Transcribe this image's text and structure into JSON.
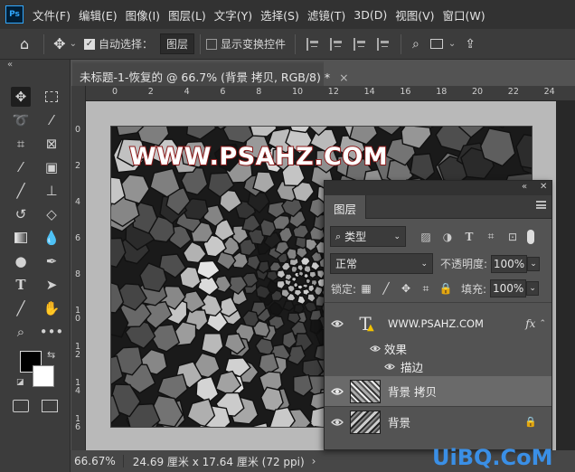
{
  "app": {
    "logo": "Ps"
  },
  "menu": [
    "文件(F)",
    "编辑(E)",
    "图像(I)",
    "图层(L)",
    "文字(Y)",
    "选择(S)",
    "滤镜(T)",
    "3D(D)",
    "视图(V)",
    "窗口(W)"
  ],
  "options": {
    "auto_select_label": "自动选择：",
    "auto_select_target": "图层",
    "show_transform_label": "显示变换控件"
  },
  "document": {
    "tab_title": "未标题-1-恢复的 @ 66.7% (背景 拷贝, RGB/8) *",
    "ruler_top": [
      "0",
      "2",
      "4",
      "6",
      "8",
      "10",
      "12",
      "14",
      "16",
      "18",
      "20",
      "22",
      "24"
    ],
    "ruler_left": [
      "0",
      "2",
      "4",
      "6",
      "8",
      "1\n0",
      "1\n2",
      "1\n4",
      "1\n6"
    ],
    "artwork_text": "WWW.PSAHZ.COM"
  },
  "status": {
    "zoom": "66.67%",
    "info": "24.69 厘米 x 17.64 厘米 (72 ppi)"
  },
  "layers_panel": {
    "tab": "图层",
    "filter_kind": "类型",
    "blend_mode": "正常",
    "opacity_label": "不透明度:",
    "opacity_value": "100%",
    "lock_label": "锁定:",
    "fill_label": "填充:",
    "fill_value": "100%",
    "layers": [
      {
        "name": "WWW.PSAHZ.COM",
        "kind": "text",
        "fx": "fx"
      },
      {
        "name": "效果",
        "kind": "effects-group"
      },
      {
        "name": "描边",
        "kind": "effect"
      },
      {
        "name": "背景 拷贝",
        "kind": "image",
        "selected": true
      },
      {
        "name": "背景",
        "kind": "image",
        "locked": true
      }
    ]
  },
  "site_watermark": "UiBQ.CoM",
  "colors": {
    "accent": "#31a8ff",
    "title_stroke": "#8c1a1a",
    "foreground_swatch": "#000000",
    "background_swatch": "#ffffff"
  }
}
